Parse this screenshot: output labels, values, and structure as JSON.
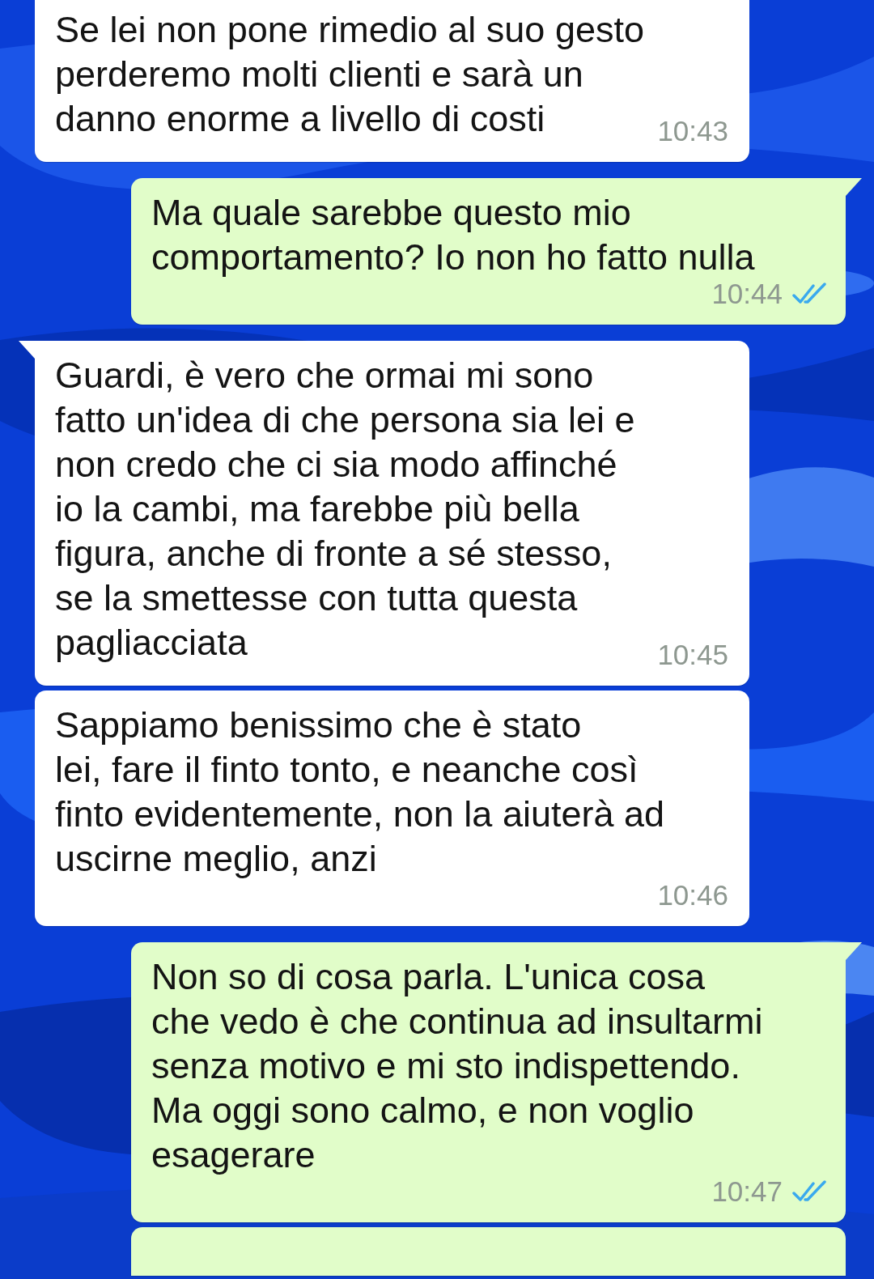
{
  "messages": [
    {
      "kind": "in",
      "tail": false,
      "text": "Se lei non pone rimedio al suo gesto\nperderemo molti clienti e sarà un\ndanno enorme a livello di costi",
      "time": "10:43"
    },
    {
      "kind": "out",
      "tail": true,
      "read": true,
      "text": "Ma quale sarebbe questo mio\ncomportamento? Io non ho fatto nulla",
      "time": "10:44"
    },
    {
      "kind": "in",
      "tail": true,
      "text": "Guardi, è vero che ormai mi sono\nfatto un'idea di che persona sia lei e\nnon credo che ci sia modo affinché\nio la cambi, ma farebbe più bella\nfigura, anche di fronte a sé stesso,\nse la smettesse con tutta questa\npagliacciata",
      "time": "10:45"
    },
    {
      "kind": "in",
      "tail": false,
      "text": "Sappiamo benissimo che è stato\nlei, fare il finto tonto, e neanche così\nfinto evidentemente, non la aiuterà ad\nuscirne meglio, anzi",
      "time": "10:46"
    },
    {
      "kind": "out",
      "tail": true,
      "read": true,
      "text": "Non so di cosa parla. L'unica cosa\nche vedo è che continua ad insultarmi\nsenza motivo e mi sto indispettendo.\nMa oggi sono calmo, e non voglio\nesagerare",
      "time": "10:47"
    },
    {
      "kind": "out",
      "tail": false
    }
  ]
}
